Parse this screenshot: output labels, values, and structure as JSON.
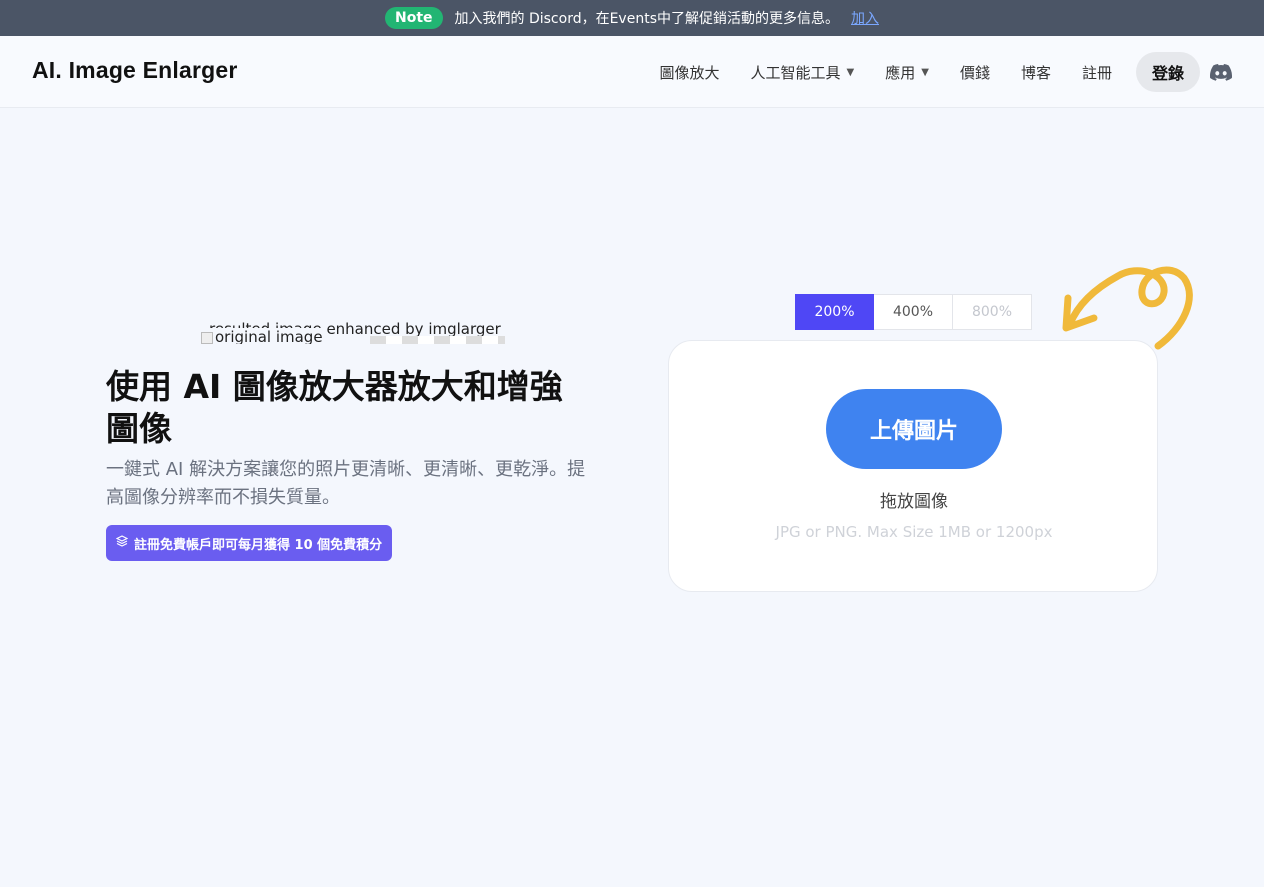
{
  "banner": {
    "badge": "Note",
    "message": "加入我們的 Discord，在Events中了解促銷活動的更多信息。",
    "link": "加入"
  },
  "header": {
    "logo": "AI. Image Enlarger",
    "nav": [
      {
        "label": "圖像放大"
      },
      {
        "label": "人工智能工具"
      },
      {
        "label": "應用"
      },
      {
        "label": "價錢"
      },
      {
        "label": "博客"
      },
      {
        "label": "註冊"
      }
    ],
    "login": "登錄",
    "discord_icon": "discord-icon"
  },
  "broken_image": {
    "alt_result": "resulted image enhanced by imglarger",
    "alt_original": "original image"
  },
  "hero": {
    "title": "使用 AI 圖像放大器放大和增強圖像",
    "subtitle": "一鍵式 AI 解決方案讓您的照片更清晰、更清晰、更乾淨。提高圖像分辨率而不損失質量。",
    "promo": "註冊免費帳戶即可每月獲得 10 個免費積分"
  },
  "scale": {
    "options": [
      "200%",
      "400%",
      "800%"
    ],
    "selected": "200%"
  },
  "upload": {
    "button": "上傳圖片",
    "drop_text": "拖放圖像",
    "hint": "JPG or PNG. Max Size 1MB or 1200px"
  },
  "colors": {
    "accent": "#4f47f5",
    "upload": "#3f83f0",
    "promo": "#6a5df0",
    "badge": "#22b573",
    "arrow": "#f0b93a"
  }
}
